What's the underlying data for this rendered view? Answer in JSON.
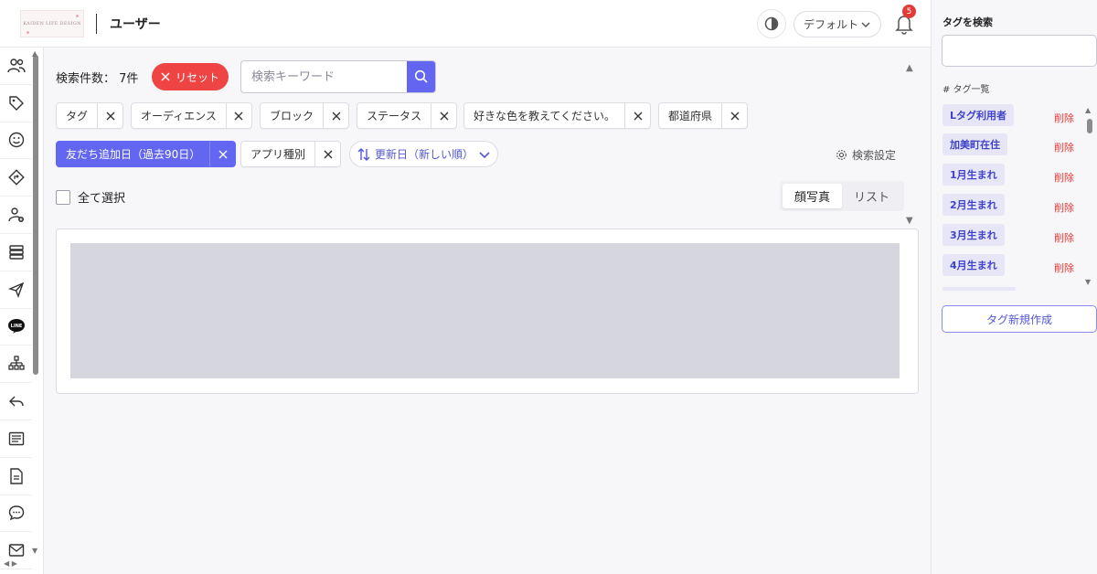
{
  "header": {
    "logo_text": "KAIDEN LIFE DESIGN",
    "page_title": "ユーザー",
    "preset_label": "デフォルト",
    "notification_count": "5"
  },
  "sidebar": {
    "items": [
      {
        "icon": "users-icon"
      },
      {
        "icon": "tag-icon"
      },
      {
        "icon": "smile-icon"
      },
      {
        "icon": "route-icon"
      },
      {
        "icon": "user-plus-icon"
      },
      {
        "icon": "database-icon"
      },
      {
        "icon": "send-icon"
      },
      {
        "icon": "line-icon",
        "text": "LINE"
      },
      {
        "icon": "sitemap-icon"
      },
      {
        "icon": "reply-icon"
      },
      {
        "icon": "list-icon"
      },
      {
        "icon": "document-icon"
      },
      {
        "icon": "chat-icon"
      },
      {
        "icon": "mail-icon"
      }
    ]
  },
  "toolbar": {
    "count_label": "検索件数：",
    "count_value": "7件",
    "reset_label": "リセット",
    "search_placeholder": "検索キーワード"
  },
  "filters": {
    "row1": [
      "タグ",
      "オーディエンス",
      "ブロック",
      "ステータス",
      "好きな色を教えてください。",
      "都道府県"
    ],
    "row2_active": "友だち追加日（過去90日）",
    "row2_app": "アプリ種別",
    "sort_label": "更新日（新しい順）",
    "settings_label": "検索設定"
  },
  "list": {
    "select_all_label": "全て選択",
    "view_options": [
      "顔写真",
      "リスト"
    ],
    "selected_view": "顔写真"
  },
  "right_panel": {
    "search_title": "タグを検索",
    "list_title": "# タグ一覧",
    "tags": [
      "Lタグ利用者",
      "加美町在住",
      "1月生まれ",
      "2月生まれ",
      "3月生まれ",
      "4月生まれ"
    ],
    "delete_label": "削除",
    "new_tag_label": "タグ新規作成"
  },
  "colors": {
    "accent": "#6366f1",
    "danger": "#ef4444",
    "tag_bg": "#e6e6f7"
  }
}
